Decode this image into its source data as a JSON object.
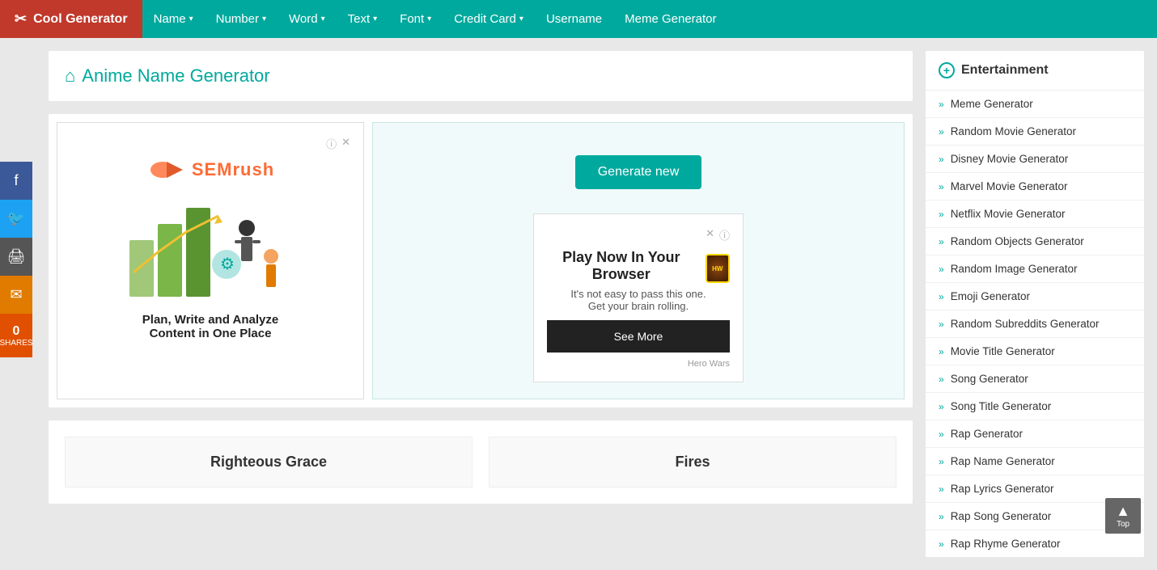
{
  "nav": {
    "brand": "Cool Generator",
    "items": [
      {
        "label": "Name",
        "hasDropdown": true
      },
      {
        "label": "Number",
        "hasDropdown": true
      },
      {
        "label": "Word",
        "hasDropdown": true
      },
      {
        "label": "Text",
        "hasDropdown": true
      },
      {
        "label": "Font",
        "hasDropdown": true
      },
      {
        "label": "Credit Card",
        "hasDropdown": true
      },
      {
        "label": "Username",
        "hasDropdown": false
      },
      {
        "label": "Meme Generator",
        "hasDropdown": false
      }
    ]
  },
  "social": {
    "shares_label": "SHARES",
    "shares_count": "0"
  },
  "page": {
    "title": "Anime Name Generator",
    "home_icon": "⌂"
  },
  "ad_left": {
    "brand": "semrush",
    "caption": "Plan, Write and Analyze\nContent in One Place"
  },
  "ad_right": {
    "generate_btn": "Generate new"
  },
  "inner_ad": {
    "title": "Play Now In Your Browser",
    "subtitle": "It's not easy to pass this one.\nGet your brain rolling.",
    "footer": "Hero Wars",
    "see_more_btn": "See More"
  },
  "results": [
    {
      "value": "Righteous Grace"
    },
    {
      "value": "Fires"
    }
  ],
  "sidebar": {
    "header": "Entertainment",
    "items": [
      "Meme Generator",
      "Random Movie Generator",
      "Disney Movie Generator",
      "Marvel Movie Generator",
      "Netflix Movie Generator",
      "Random Objects Generator",
      "Random Image Generator",
      "Emoji Generator",
      "Random Subreddits Generator",
      "Movie Title Generator",
      "Song Generator",
      "Song Title Generator",
      "Rap Generator",
      "Rap Name Generator",
      "Rap Lyrics Generator",
      "Rap Song Generator",
      "Rap Rhyme Generator"
    ]
  },
  "scroll_top": "Top"
}
